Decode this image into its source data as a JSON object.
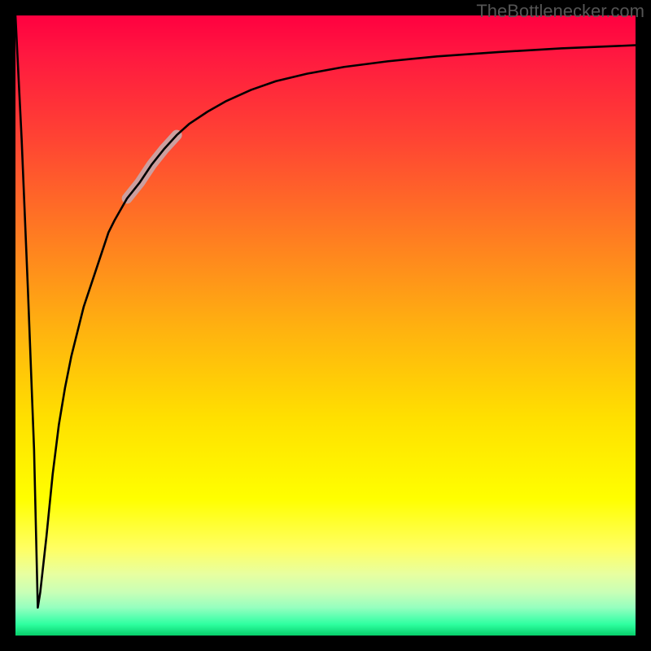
{
  "watermark": {
    "text": "TheBottlenecker.com"
  },
  "chart_data": {
    "type": "line",
    "title": "",
    "xlabel": "",
    "ylabel": "",
    "xlim": [
      0,
      100
    ],
    "ylim": [
      0,
      100
    ],
    "annotations": [
      {
        "label": "highlighted-segment",
        "x_range": [
          18,
          26
        ]
      }
    ],
    "series": [
      {
        "name": "bottleneck-curve",
        "x": [
          0,
          1,
          2,
          3,
          3.6,
          4,
          5,
          6,
          7,
          8,
          9,
          10,
          11,
          12,
          13,
          14,
          15,
          16,
          18,
          20,
          22,
          24,
          26,
          28,
          31,
          34,
          38,
          42,
          47,
          53,
          60,
          68,
          78,
          88,
          100
        ],
        "y": [
          100,
          80,
          56,
          30,
          4.5,
          7,
          16,
          26,
          34,
          40,
          45,
          49,
          53,
          56,
          59,
          62,
          65,
          67,
          70.5,
          73,
          76,
          78.5,
          80.7,
          82.5,
          84.5,
          86.2,
          88,
          89.4,
          90.6,
          91.7,
          92.6,
          93.4,
          94.1,
          94.7,
          95.2
        ]
      }
    ]
  }
}
